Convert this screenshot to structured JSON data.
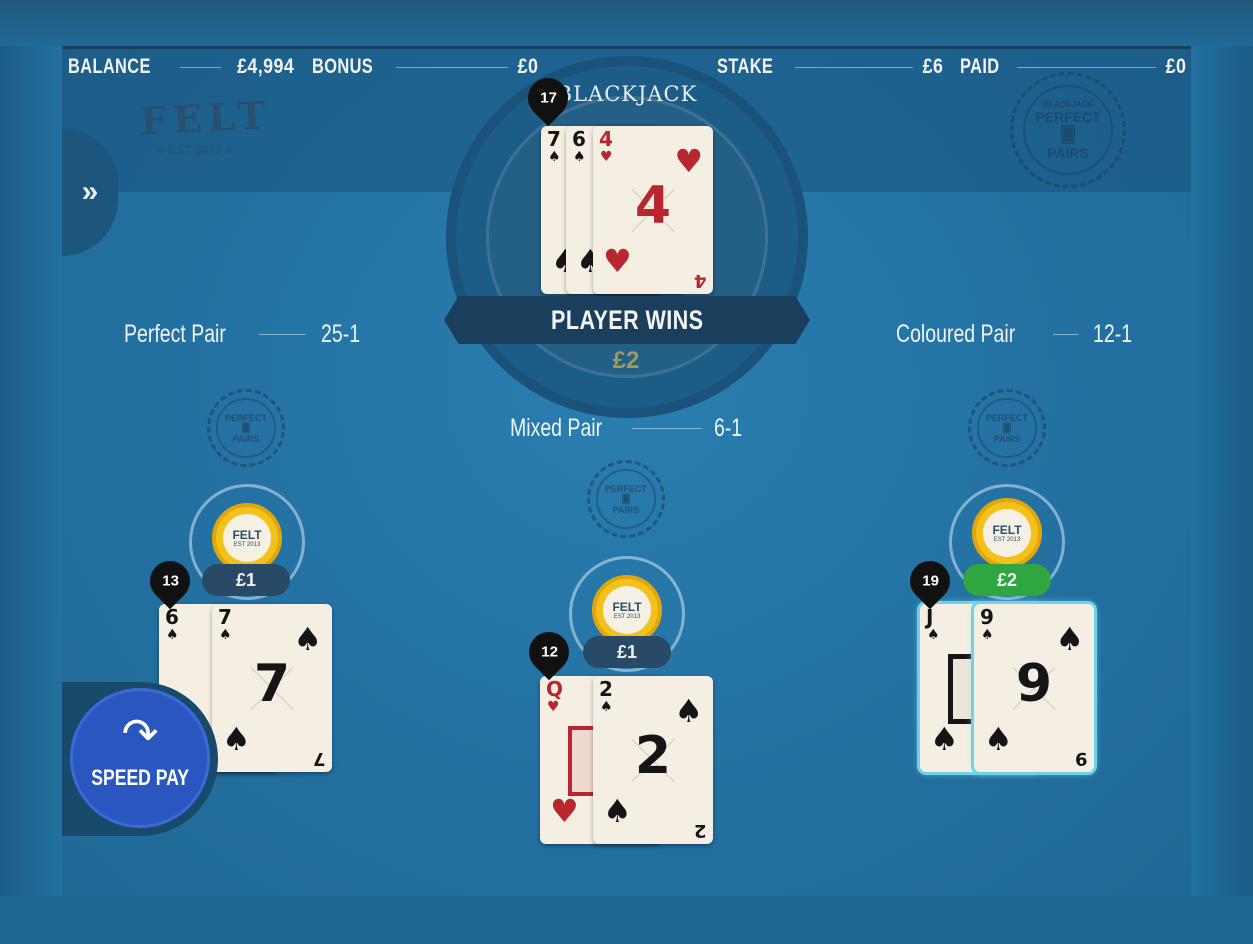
{
  "header": {
    "balance": {
      "label": "BALANCE",
      "value": "£4,994"
    },
    "bonus": {
      "label": "BONUS",
      "value": "£0"
    },
    "stake": {
      "label": "STAKE",
      "value": "£6"
    },
    "paid": {
      "label": "PAID",
      "value": "£0"
    }
  },
  "logo": {
    "word": "FELT",
    "est": "EST 2013"
  },
  "badge": {
    "top": "BLACKJACK",
    "mid": "PERFECT",
    "bottom": "PAIRS"
  },
  "menu": {
    "icon": "chevron-double-right-icon",
    "glyph": "»"
  },
  "dealer": {
    "title": "BLACKJACK",
    "score": "17",
    "cards": [
      {
        "rank": "7",
        "suit": "♠",
        "color": "black"
      },
      {
        "rank": "6",
        "suit": "♠",
        "color": "black"
      },
      {
        "rank": "4",
        "suit": "♥",
        "color": "red"
      }
    ],
    "result": "PLAYER WINS",
    "win_amount": "£2"
  },
  "payouts": {
    "perfect": {
      "label": "Perfect Pair",
      "value": "25-1"
    },
    "coloured": {
      "label": "Coloured Pair",
      "value": "12-1"
    },
    "mixed": {
      "label": "Mixed Pair",
      "value": "6-1"
    }
  },
  "chip": {
    "word": "FELT",
    "sub": "EST 2013"
  },
  "hands": {
    "left": {
      "score": "13",
      "bet": "£1",
      "cards": [
        {
          "rank": "6",
          "suit": "♠"
        },
        {
          "rank": "7",
          "suit": "♠"
        }
      ]
    },
    "middle": {
      "score": "12",
      "bet": "£1",
      "cards": [
        {
          "rank": "Q",
          "suit": "♥"
        },
        {
          "rank": "2",
          "suit": "♠"
        }
      ]
    },
    "right": {
      "score": "19",
      "bet": "£2",
      "cards": [
        {
          "rank": "J",
          "suit": "♠"
        },
        {
          "rank": "9",
          "suit": "♠"
        }
      ]
    }
  },
  "speed_pay": {
    "label": "SPEED PAY",
    "icon": "curved-arrow-icon",
    "glyph": "↷"
  },
  "colors": {
    "table": "#2371a2",
    "win_pill": "#2fa640",
    "speed_pay": "#2a56c0",
    "chip": "#f2c21a"
  }
}
